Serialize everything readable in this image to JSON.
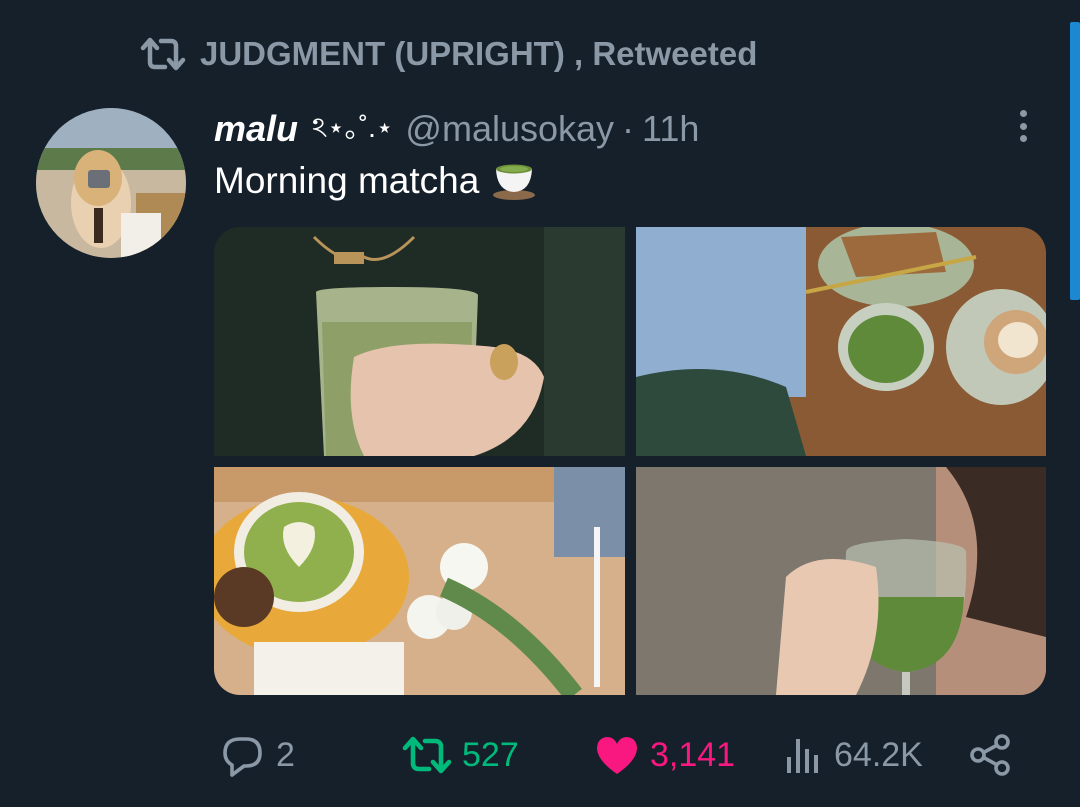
{
  "retweet_banner": {
    "text": "JUDGMENT (UPRIGHT) , Retweeted"
  },
  "tweet": {
    "display_name": "malu",
    "name_decoration": "ঽ⋆｡˚.⋆",
    "handle": "@malusokay",
    "separator": "·",
    "time": "11h",
    "text": "Morning matcha",
    "emoji": "teacup-icon"
  },
  "actions": {
    "replies": "2",
    "retweets": "527",
    "likes": "3,141",
    "views": "64.2K"
  },
  "colors": {
    "background": "#15202b",
    "secondary_text": "#8b98a5",
    "retweet_active": "#00ba7c",
    "like_active": "#f91880",
    "accent": "#1d9bf0"
  }
}
